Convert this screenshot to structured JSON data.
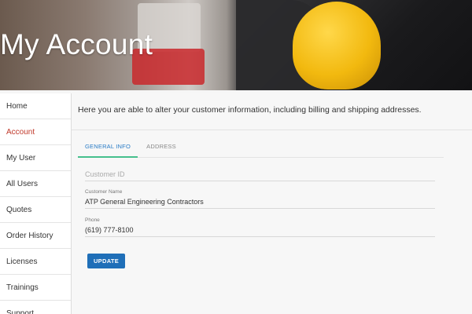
{
  "header": {
    "title": "My Account"
  },
  "sidebar": {
    "items": [
      {
        "label": "Home"
      },
      {
        "label": "Account"
      },
      {
        "label": "My User"
      },
      {
        "label": "All Users"
      },
      {
        "label": "Quotes"
      },
      {
        "label": "Order History"
      },
      {
        "label": "Licenses"
      },
      {
        "label": "Trainings"
      },
      {
        "label": "Support"
      }
    ],
    "active_index": 1
  },
  "main": {
    "intro": "Here you are able to alter your customer information, including billing and shipping addresses.",
    "tabs": [
      {
        "label": "GENERAL INFO",
        "active": true
      },
      {
        "label": "ADDRESS",
        "active": false
      }
    ],
    "form": {
      "customer_id": {
        "placeholder": "Customer ID",
        "value": ""
      },
      "customer_name": {
        "label": "Customer Name",
        "value": "ATP General Engineering Contractors"
      },
      "phone": {
        "label": "Phone",
        "value": "(619) 777-8100"
      }
    },
    "update_label": "UPDATE"
  },
  "colors": {
    "active_nav": "#c0392b",
    "tab_active_text": "#2a7cc6",
    "tab_underline": "#46c08d",
    "button": "#1f6fb8"
  }
}
